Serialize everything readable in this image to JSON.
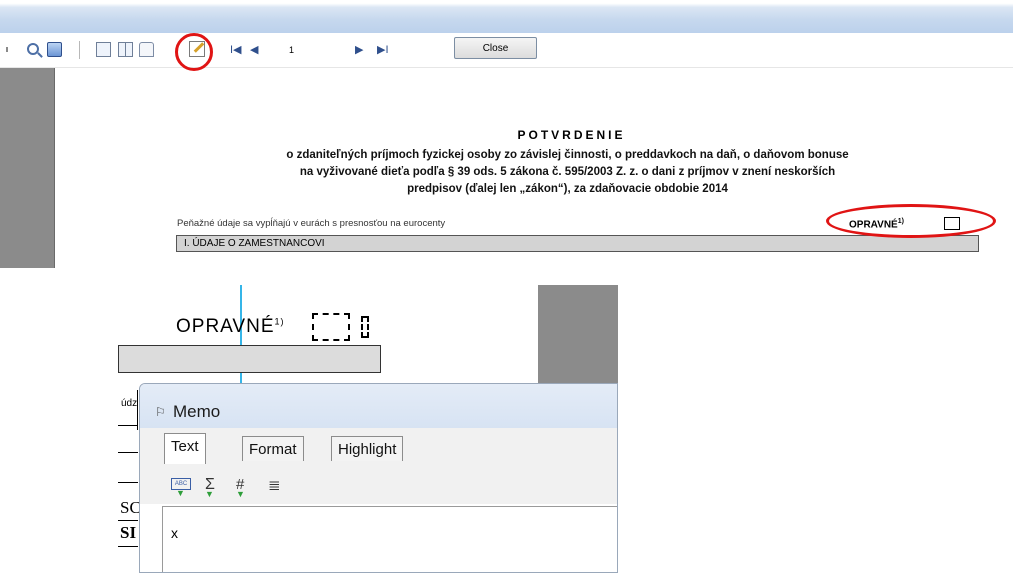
{
  "toolbar": {
    "page_number": "1",
    "close_label": "Close",
    "icons": [
      "zoom-icon",
      "page-view-icon",
      "single-page-icon",
      "two-pages-icon",
      "bookmark-icon",
      "edit-icon",
      "first-page-icon",
      "prev-page-icon",
      "next-page-icon",
      "last-page-icon"
    ],
    "first_glyph": "I◀",
    "prev_glyph": "◀",
    "next_glyph": "▶",
    "last_glyph": "▶I"
  },
  "document": {
    "heading": "POTVRDENIE",
    "body_lines": [
      "o zdaniteľných príjmoch fyzickej osoby zo závislej činnosti, o preddavkoch na daň, o daňovom bonuse",
      "na vyživované dieťa podľa § 39 ods. 5 zákona č. 595/2003 Z. z. o dani z príjmov v znení neskorších",
      "predpisov (ďalej len „zákon“), za zdaňovacie obdobie 2014"
    ],
    "note": "Peňažné údaje sa vypĺňajú v eurách s presnosťou na eurocenty",
    "opravne_label": "OPRAVNÉ",
    "opravne_sup": "1)",
    "section_label": "I. ÚDAJE O ZAMESTNANCOVI"
  },
  "designer": {
    "opravne_label": "OPRAVNÉ",
    "opravne_sup": "1)",
    "left_text_udz": "údz",
    "left_text_s1": "SC",
    "left_text_s2": "SI"
  },
  "memo": {
    "title": "Memo",
    "tabs": [
      {
        "label": "Text"
      },
      {
        "label": "Format"
      },
      {
        "label": "Highlight"
      }
    ],
    "tools": [
      "spell-check-icon",
      "sum-icon",
      "hash-icon",
      "align-icon"
    ],
    "editor_text": "x"
  },
  "colors": {
    "highlight_ring": "#e01414",
    "guide_line": "#35b5e8",
    "gray_panel": "#8b8b8b"
  }
}
